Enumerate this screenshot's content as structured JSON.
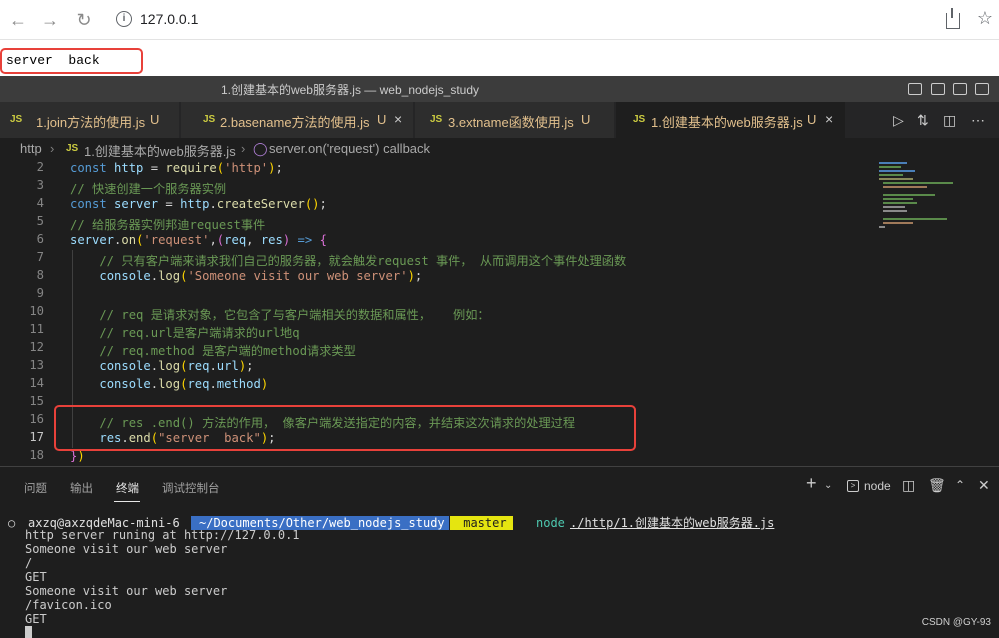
{
  "browser": {
    "url": "127.0.0.1",
    "page_text": "server  back"
  },
  "window": {
    "title": "1.创建基本的web服务器.js — web_nodejs_study"
  },
  "tabs": [
    {
      "icon": "JS",
      "label": "1.join方法的使用.js",
      "badge": "U",
      "active": false
    },
    {
      "icon": "JS",
      "label": "2.basename方法的使用.js",
      "badge": "U",
      "active": false,
      "close": "×"
    },
    {
      "icon": "JS",
      "label": "3.extname函数使用.js",
      "badge": "U",
      "active": false
    },
    {
      "icon": "JS",
      "label": "1.创建基本的web服务器.js",
      "badge": "U",
      "active": true,
      "close": "×"
    }
  ],
  "breadcrumb": {
    "folder": "http",
    "file_icon": "JS",
    "file": "1.创建基本的web服务器.js",
    "symbol": "server.on('request') callback"
  },
  "editor": {
    "lines": [
      {
        "n": "2",
        "t": "const http = require('http');"
      },
      {
        "n": "3",
        "t": "// 快速创建一个服务器实例"
      },
      {
        "n": "4",
        "t": "const server = http.createServer();"
      },
      {
        "n": "5",
        "t": "// 给服务器实例邦迪request事件"
      },
      {
        "n": "6",
        "t": "server.on('request',(req, res) => {"
      },
      {
        "n": "7",
        "t": "    // 只有客户端来请求我们自己的服务器，就会触发request 事件， 从而调用这个事件处理函数"
      },
      {
        "n": "8",
        "t": "    console.log('Someone visit our web server');"
      },
      {
        "n": "9",
        "t": ""
      },
      {
        "n": "10",
        "t": "    // req 是请求对象，它包含了与客户端相关的数据和属性，   例如："
      },
      {
        "n": "11",
        "t": "    // req.url是客户端请求的url地q"
      },
      {
        "n": "12",
        "t": "    // req.method 是客户端的method请求类型"
      },
      {
        "n": "13",
        "t": "    console.log(req.url);"
      },
      {
        "n": "14",
        "t": "    console.log(req.method)"
      },
      {
        "n": "15",
        "t": ""
      },
      {
        "n": "16",
        "t": "    // res .end() 方法的作用， 像客户端发送指定的内容，并结束这次请求的处理过程"
      },
      {
        "n": "17",
        "t": "    res.end(\"server  back\");"
      },
      {
        "n": "18",
        "t": "})"
      }
    ]
  },
  "panel": {
    "tabs": [
      "问题",
      "输出",
      "终端",
      "调试控制台"
    ],
    "active_tab": "终端",
    "terminal_name": "node",
    "add": "+",
    "terminal_icon": ">"
  },
  "terminal": {
    "prompt_user": "axzq@axzqdeMac-mini-6",
    "prompt_path": "~/Documents/Other/web_nodejs_study",
    "prompt_branch": " master",
    "command": "node",
    "command_arg": "./http/1.创建基本的web服务器.js",
    "output": [
      "http server runing at http://127.0.0.1",
      "Someone visit our web server",
      "/",
      "GET",
      "Someone visit our web server",
      "/favicon.ico",
      "GET"
    ]
  },
  "watermark": "CSDN @GY-93",
  "colors": {
    "highlight_box": "#e8413a",
    "editor_bg": "#1e1e1e",
    "prompt_user_bg": "#1e1e1e",
    "prompt_path_bg": "#3a6fc4",
    "prompt_branch_bg": "#e5e510"
  }
}
